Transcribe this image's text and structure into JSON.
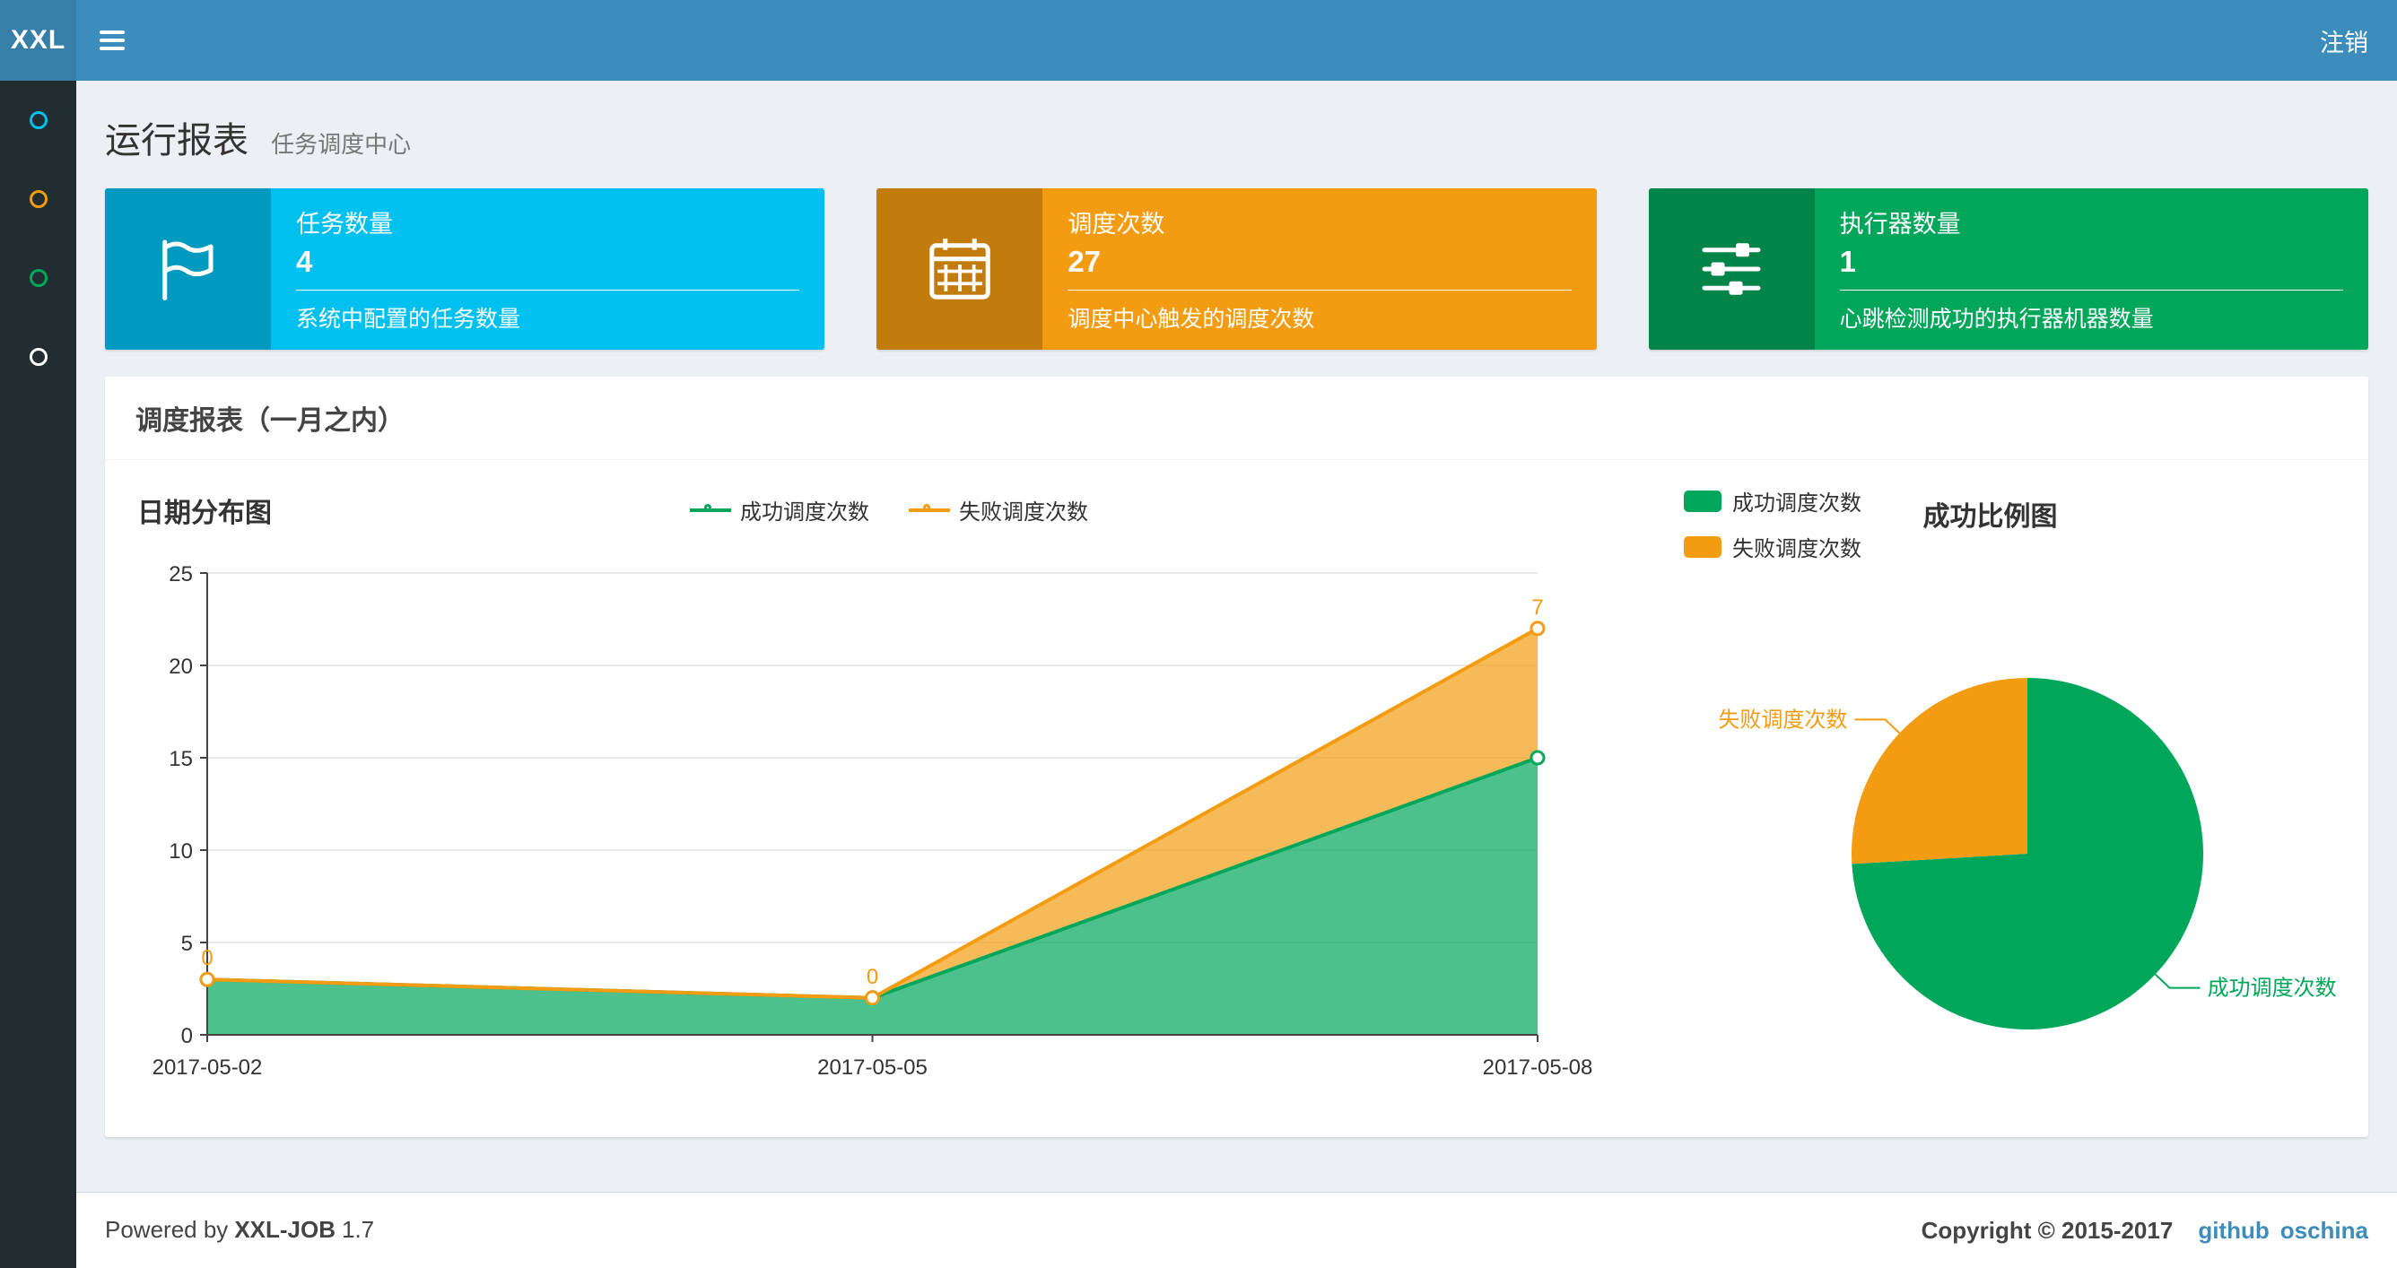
{
  "navbar": {
    "logo_text": "XXL",
    "logout_label": "注销"
  },
  "sidebar": {
    "items": [
      {
        "name": "menu-item-1",
        "color": "#00c0ef"
      },
      {
        "name": "menu-item-2",
        "color": "#f39c12"
      },
      {
        "name": "menu-item-3",
        "color": "#00a65a"
      },
      {
        "name": "menu-item-4",
        "color": "#ffffff"
      }
    ]
  },
  "header": {
    "title": "运行报表",
    "subtitle": "任务调度中心"
  },
  "info_boxes": [
    {
      "label": "任务数量",
      "value": "4",
      "desc": "系统中配置的任务数量",
      "color": "#00c0ef",
      "icon": "flag-icon"
    },
    {
      "label": "调度次数",
      "value": "27",
      "desc": "调度中心触发的调度次数",
      "color": "#f39c12",
      "icon": "calendar-icon"
    },
    {
      "label": "执行器数量",
      "value": "1",
      "desc": "心跳检测成功的执行器机器数量",
      "color": "#00a65a",
      "icon": "sliders-icon"
    }
  ],
  "panel": {
    "title": "调度报表（一月之内）"
  },
  "chart_data": [
    {
      "type": "area",
      "title": "日期分布图",
      "x": [
        "2017-05-02",
        "2017-05-05",
        "2017-05-08"
      ],
      "series": [
        {
          "name": "成功调度次数",
          "values": [
            3,
            2,
            15
          ],
          "color": "#00a65a"
        },
        {
          "name": "失败调度次数",
          "values": [
            0,
            0,
            7
          ],
          "color": "#f39c12",
          "point_labels": [
            "0",
            "0",
            "7"
          ]
        }
      ],
      "stacked": true,
      "ylim": [
        0,
        25
      ],
      "yticks": [
        0,
        5,
        10,
        15,
        20,
        25
      ],
      "grid": true,
      "legend_position": "top-center"
    },
    {
      "type": "pie",
      "title": "成功比例图",
      "slices": [
        {
          "name": "成功调度次数",
          "value": 20,
          "color": "#00a65a"
        },
        {
          "name": "失败调度次数",
          "value": 7,
          "color": "#f39c12"
        }
      ],
      "legend_position": "top-left"
    }
  ],
  "footer": {
    "powered_prefix": "Powered by",
    "brand": "XXL-JOB",
    "version": "1.7",
    "copyright": "Copyright © 2015-2017",
    "links": [
      {
        "label": "github"
      },
      {
        "label": "oschina"
      }
    ],
    "link_color": "#3c8dbc"
  }
}
